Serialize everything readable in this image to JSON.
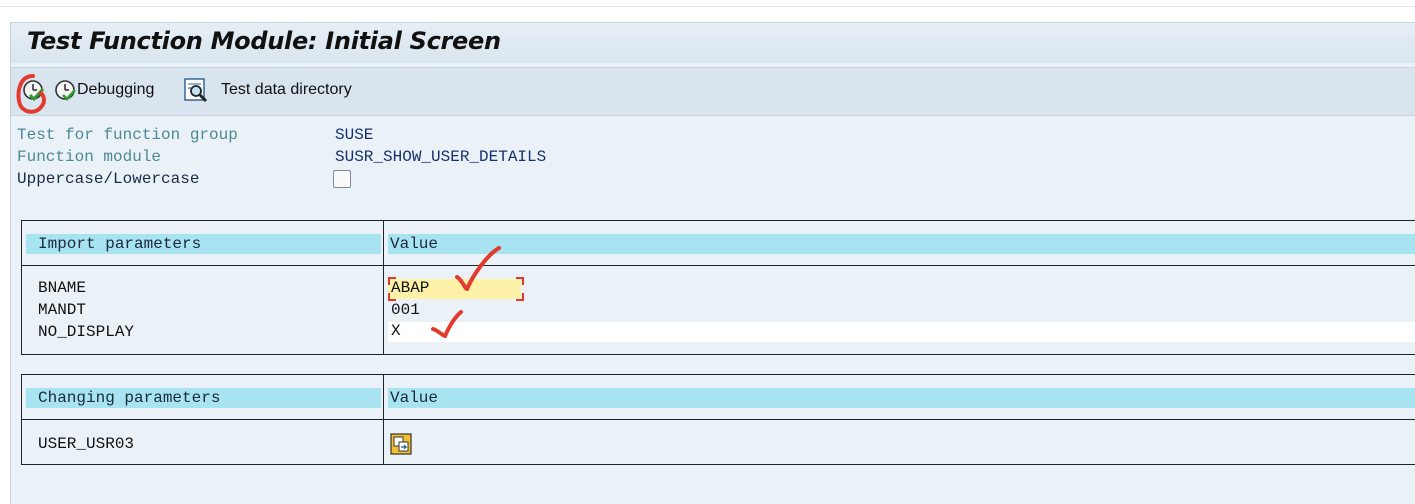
{
  "window": {
    "title": "Test Function Module: Initial Screen"
  },
  "toolbar": {
    "execute_icon": "execute-icon",
    "debugging_label": "Debugging",
    "test_data_directory_label": "Test data directory"
  },
  "header_fields": {
    "function_group_label": "Test for function group",
    "function_group_value": "SUSE",
    "function_module_label": "Function module",
    "function_module_value": "SUSR_SHOW_USER_DETAILS",
    "case_label": "Uppercase/Lowercase",
    "case_checked": false
  },
  "import_parameters": {
    "header_name": "Import parameters",
    "header_value": "Value",
    "rows": [
      {
        "name": "BNAME",
        "value": "ABAP"
      },
      {
        "name": "MANDT",
        "value": "001"
      },
      {
        "name": "NO_DISPLAY",
        "value": "X"
      }
    ]
  },
  "changing_parameters": {
    "header_name": "Changing parameters",
    "header_value": "Value",
    "rows": [
      {
        "name": "USER_USR03",
        "value_icon": "structure-edit-icon"
      }
    ]
  },
  "colors": {
    "header_band": "#a8e3f2",
    "focus_field": "#fff1a8",
    "annotation": "#e23a2f"
  }
}
